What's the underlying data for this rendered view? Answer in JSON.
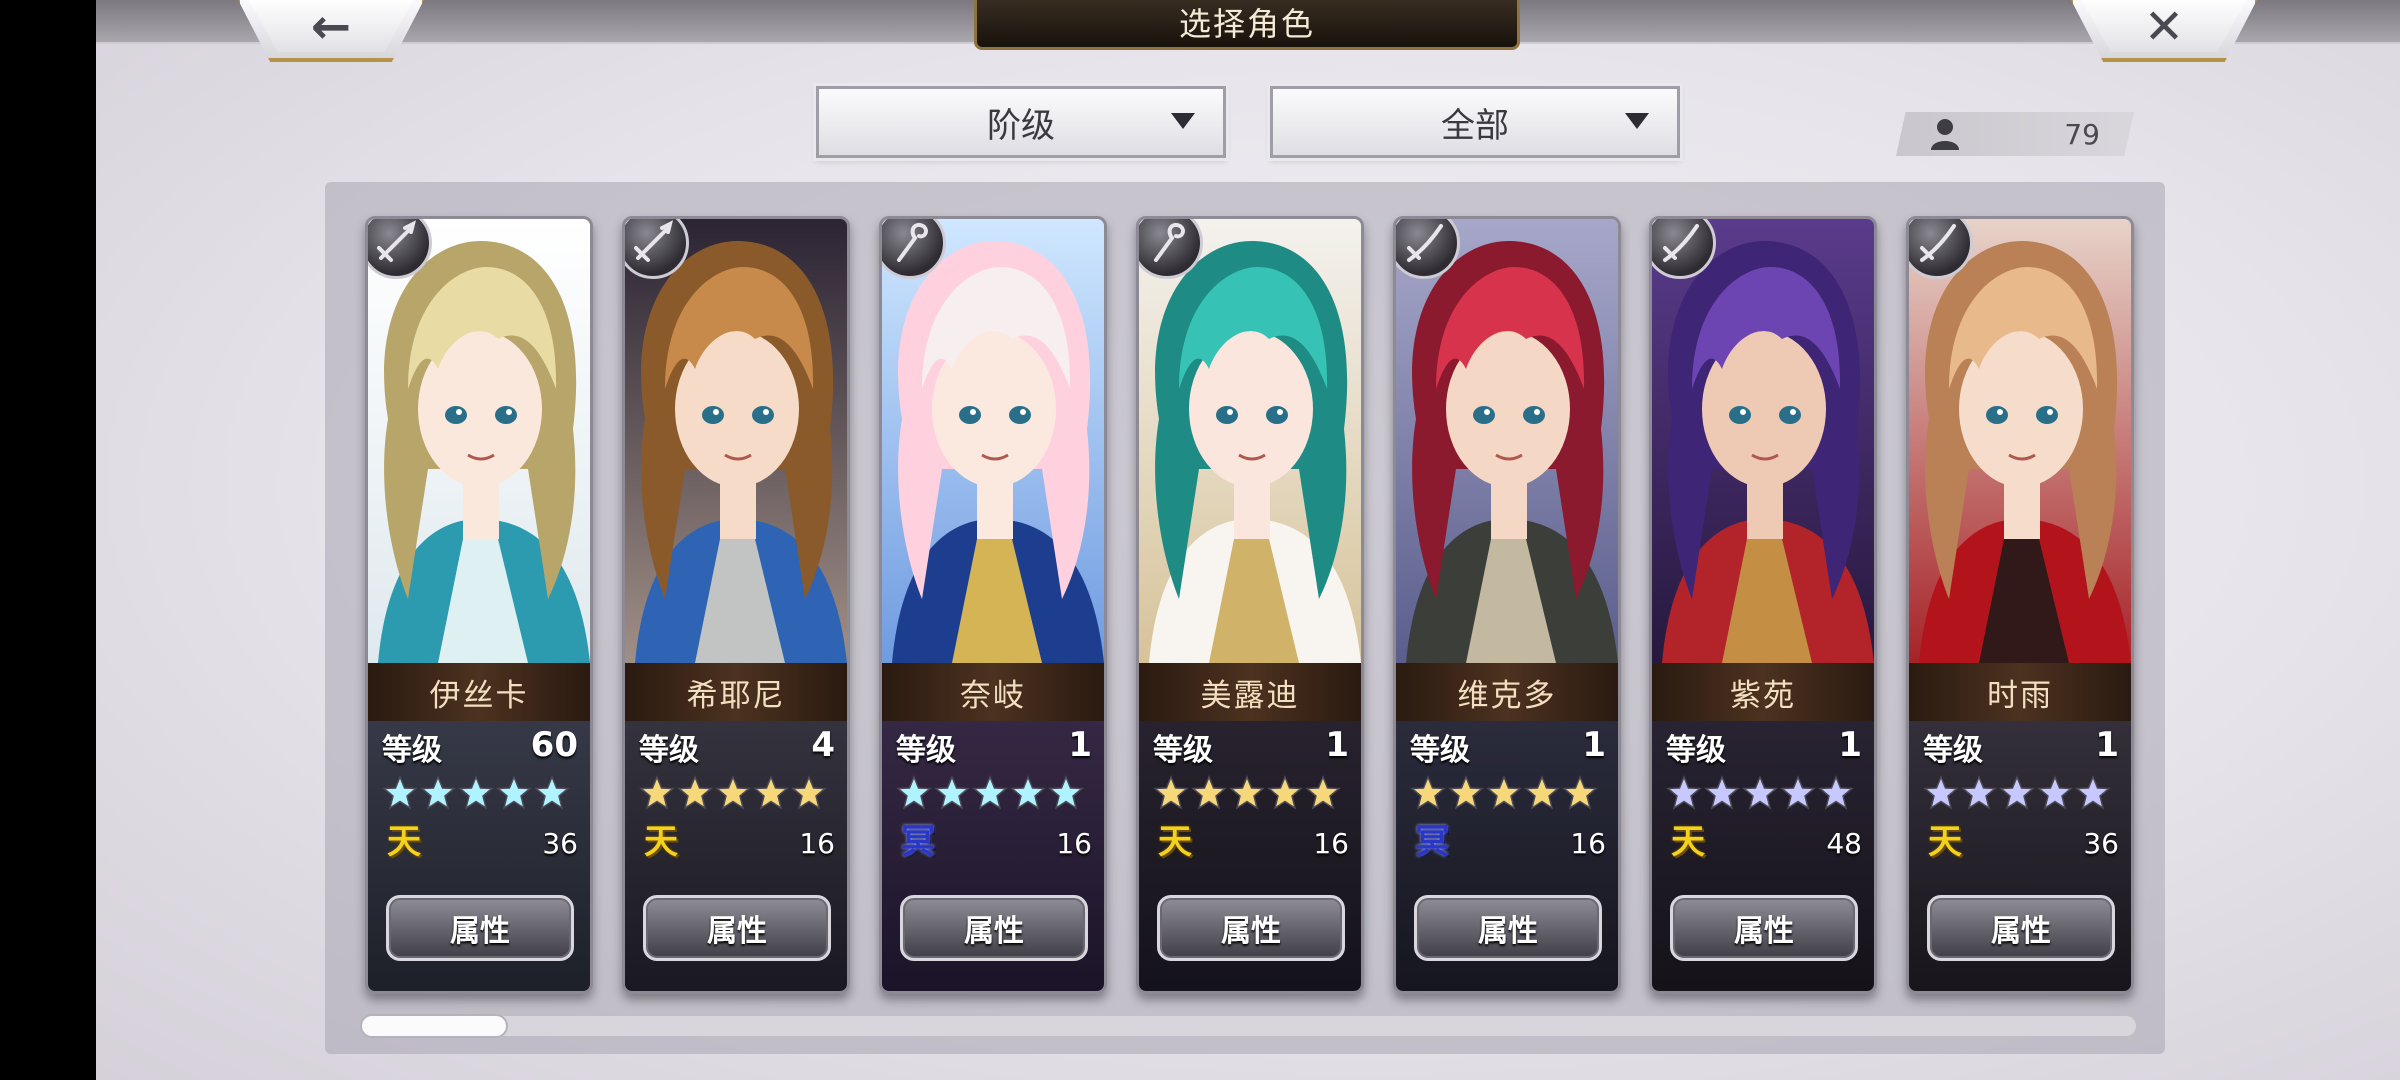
{
  "header": {
    "title": "选择角色",
    "back_icon": "back-arrow-icon",
    "close_icon": "close-x-icon",
    "back_glyph": "←",
    "close_glyph": "✕"
  },
  "filters": {
    "sort_label": "阶级",
    "category_label": "全部"
  },
  "roster_count": "79",
  "attr_label": "属性",
  "level_label": "等级",
  "colors": {
    "gold_star": "#f6d77a",
    "blue_star": "#aef3ff",
    "lavender_star": "#c7c8ff"
  },
  "characters": [
    {
      "name": "伊丝卡",
      "level": "60",
      "stars": 5,
      "star_color": "blue",
      "element": "天",
      "element_type": "heaven",
      "element_value": "36",
      "weapon": "sword-icon"
    },
    {
      "name": "希耶尼",
      "level": "4",
      "stars": 5,
      "star_color": "gold",
      "element": "天",
      "element_type": "heaven",
      "element_value": "16",
      "weapon": "sword-icon"
    },
    {
      "name": "奈岐",
      "level": "1",
      "stars": 5,
      "star_color": "blue",
      "element": "冥",
      "element_type": "dark",
      "element_value": "16",
      "weapon": "staff-icon"
    },
    {
      "name": "美露迪",
      "level": "1",
      "stars": 5,
      "star_color": "gold",
      "element": "天",
      "element_type": "heaven",
      "element_value": "16",
      "weapon": "staff-icon"
    },
    {
      "name": "维克多",
      "level": "1",
      "stars": 5,
      "star_color": "gold",
      "element": "冥",
      "element_type": "dark",
      "element_value": "16",
      "weapon": "katana-icon"
    },
    {
      "name": "紫苑",
      "level": "1",
      "stars": 5,
      "star_color": "lavender",
      "element": "天",
      "element_type": "heaven",
      "element_value": "48",
      "weapon": "katana-icon"
    },
    {
      "name": "时雨",
      "level": "1",
      "stars": 5,
      "star_color": "lavender",
      "element": "天",
      "element_type": "heaven",
      "element_value": "36",
      "weapon": "katana-icon"
    }
  ]
}
